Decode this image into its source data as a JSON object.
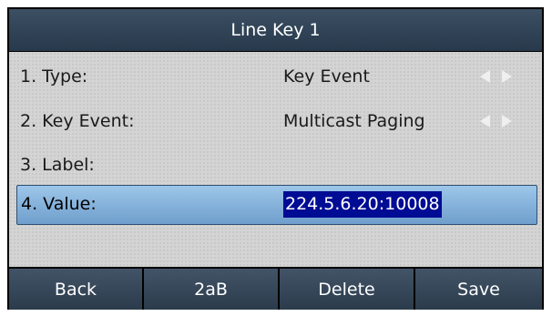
{
  "title": "Line Key 1",
  "rows": [
    {
      "label": "1. Type:",
      "value": "Key Event",
      "left_arrow_icon": "triangle-left-icon",
      "right_arrow_icon": "triangle-right-icon"
    },
    {
      "label": "2. Key Event:",
      "value": "Multicast Paging",
      "left_arrow_icon": "triangle-left-icon",
      "right_arrow_icon": "triangle-right-icon"
    },
    {
      "label": "3. Label:",
      "value": ""
    },
    {
      "label": "4. Value:",
      "value": "224.5.6.20:10008",
      "selected": true
    }
  ],
  "softkeys": [
    "Back",
    "2aB",
    "Delete",
    "Save"
  ],
  "colors": {
    "title_bar": "#2f4255",
    "selection_highlight": "#7eabd6",
    "text_selection": "#000c94",
    "softkey": "#34475a"
  }
}
